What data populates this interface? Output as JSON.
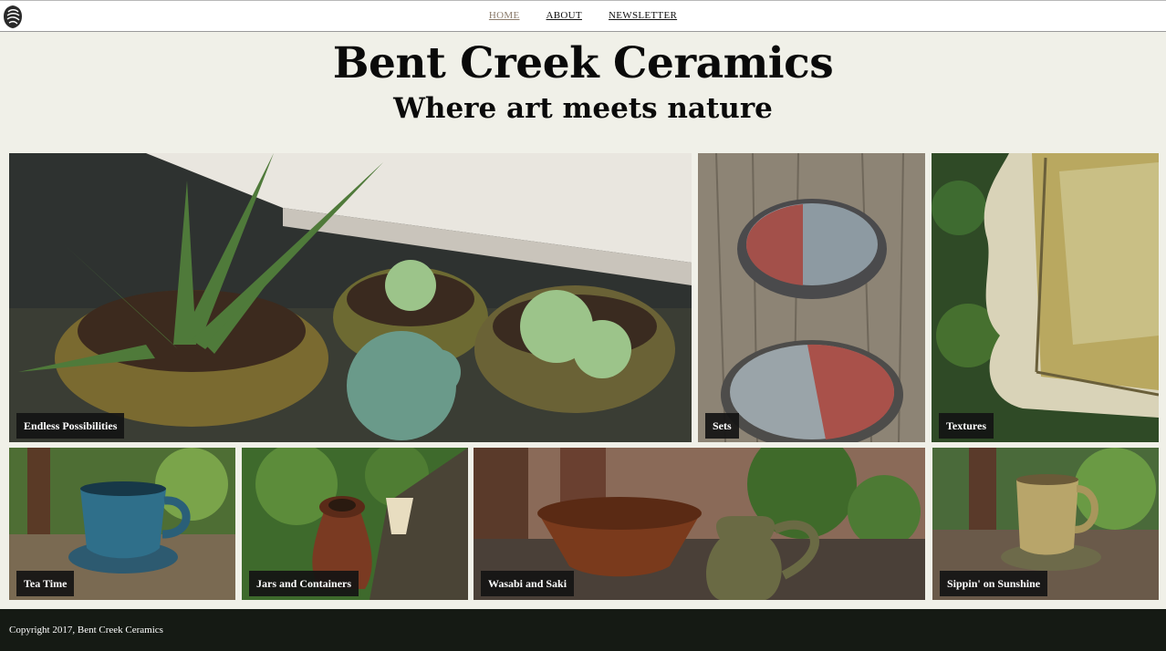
{
  "nav": {
    "items": [
      {
        "label": "HOME",
        "active": true
      },
      {
        "label": "ABOUT",
        "active": false
      },
      {
        "label": "NEWSLETTER",
        "active": false
      }
    ]
  },
  "hero": {
    "title": "Bent Creek Ceramics",
    "subtitle": "Where art meets nature"
  },
  "gallery": {
    "tiles": [
      {
        "caption": "Endless Possibilities",
        "photo": "potted succulents and aloe"
      },
      {
        "caption": "Sets",
        "photo": "two glazed bowls"
      },
      {
        "caption": "Textures",
        "photo": "glazed platter closeup"
      },
      {
        "caption": "Tea Time",
        "photo": "blue cup and saucer"
      },
      {
        "caption": "Jars and Containers",
        "photo": "brown jar with cork"
      },
      {
        "caption": "Wasabi and Saki",
        "photo": "bowl and green jug"
      },
      {
        "caption": "Sippin' on Sunshine",
        "photo": "yellow mug on saucer"
      }
    ]
  },
  "footer": {
    "copyright": "Copyright 2017, Bent Creek Ceramics"
  },
  "colors": {
    "background": "#f0f0e8",
    "footer": "#151a14",
    "nav_active": "#8a7a6a",
    "caption_bg": "#141414"
  }
}
